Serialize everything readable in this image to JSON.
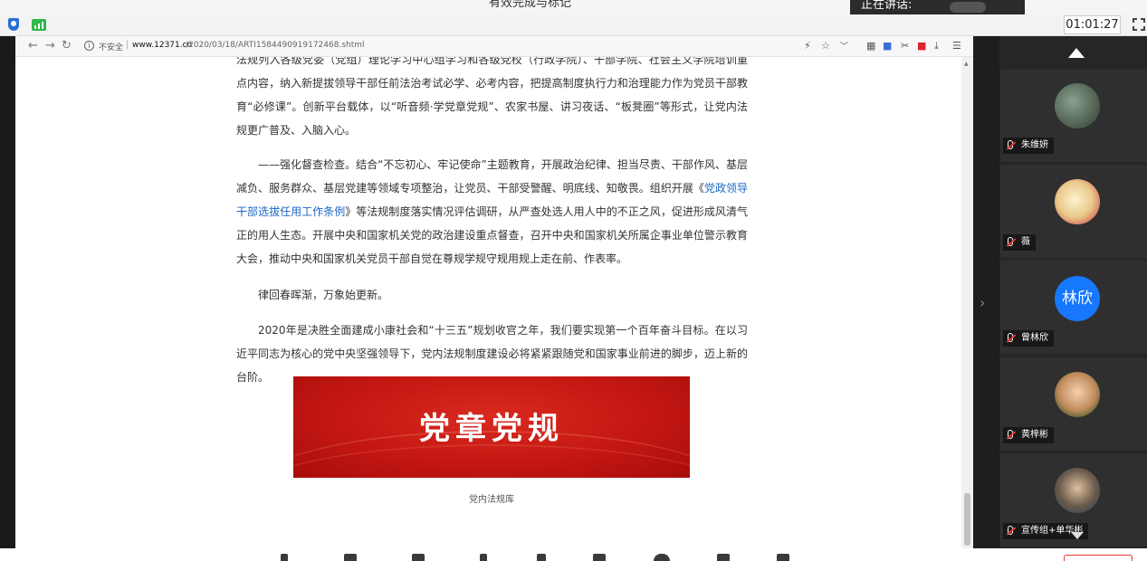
{
  "meeting": {
    "title": "有效完成与标记",
    "speaker_label": "正在讲话:",
    "timer": "01:01:27"
  },
  "browser": {
    "security_label": "不安全",
    "url_host": "www.12371.cn",
    "url_path": "/2020/03/18/ARTI1584490919172468.shtml"
  },
  "article": {
    "p1": "法规列入各级党委（党组）理论学习中心组学习和各级党校（行政学院）、干部学院、社会主义学院培训重点内容，纳入新提拔领导干部任前法治考试必学、必考内容，把提高制度执行力和治理能力作为党员干部教育“必修课”。创新平台载体，以“听音频·学党章党规”、农家书屋、讲习夜话、“板凳圈”等形式，让党内法规更广普及、入脑入心。",
    "p2_before": "——强化督查检查。结合“不忘初心、牢记使命”主题教育，开展政治纪律、担当尽责、干部作风、基层减负、服务群众、基层党建等领域专项整治，让党员、干部受警醒、明底线、知敬畏。组织开展《",
    "p2_link": "党政领导干部选拔任用工作条例",
    "p2_after": "》等法规制度落实情况评估调研，从严查处选人用人中的不正之风，促进形成风清气正的用人生态。开展中央和国家机关党的政治建设重点督查，召开中央和国家机关所属企事业单位警示教育大会，推动中央和国家机关党员干部自觉在尊规学规守规用规上走在前、作表率。",
    "p3": "律回春晖渐，万象始更新。",
    "p4": "2020年是决胜全面建成小康社会和“十三五”规划收官之年，我们要实现第一个百年奋斗目标。在以习近平同志为核心的党中央坚强领导下，党内法规制度建设必将紧紧跟随党和国家事业前进的脚步，迈上新的台阶。",
    "banner_text": "党章党规",
    "caption": "党内法规库"
  },
  "participants": [
    {
      "name": "朱维妍",
      "avatar": "photo",
      "color": "#5a6b5a"
    },
    {
      "name": "薇",
      "avatar": "photo",
      "color": "#e8d7b0"
    },
    {
      "name": "曾林欣",
      "avatar": "text",
      "initials": "林欣",
      "color": "#1677ff"
    },
    {
      "name": "黄梓彬",
      "avatar": "photo",
      "color": "#8a6a4a"
    },
    {
      "name": "宣传组+单华彬",
      "avatar": "photo",
      "color": "#7a8a7a"
    }
  ]
}
